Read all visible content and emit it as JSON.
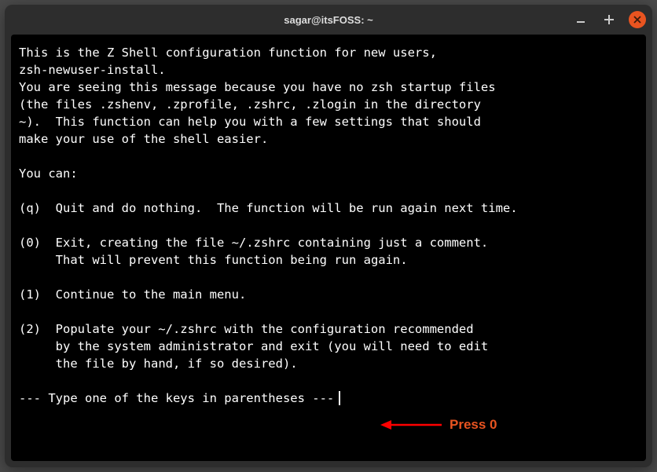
{
  "window": {
    "title": "sagar@itsFOSS: ~"
  },
  "terminal": {
    "intro": "This is the Z Shell configuration function for new users,\nzsh-newuser-install.\nYou are seeing this message because you have no zsh startup files\n(the files .zshenv, .zprofile, .zshrc, .zlogin in the directory\n~).  This function can help you with a few settings that should\nmake your use of the shell easier.\n\nYou can:\n\n(q)  Quit and do nothing.  The function will be run again next time.\n\n(0)  Exit, creating the file ~/.zshrc containing just a comment.\n     That will prevent this function being run again.\n\n(1)  Continue to the main menu.\n\n(2)  Populate your ~/.zshrc with the configuration recommended\n     by the system administrator and exit (you will need to edit\n     the file by hand, if so desired).",
    "prompt": "--- Type one of the keys in parentheses ---"
  },
  "annotation": {
    "label": "Press 0",
    "arrow_color": "#ff0000",
    "label_color": "#e95420"
  }
}
